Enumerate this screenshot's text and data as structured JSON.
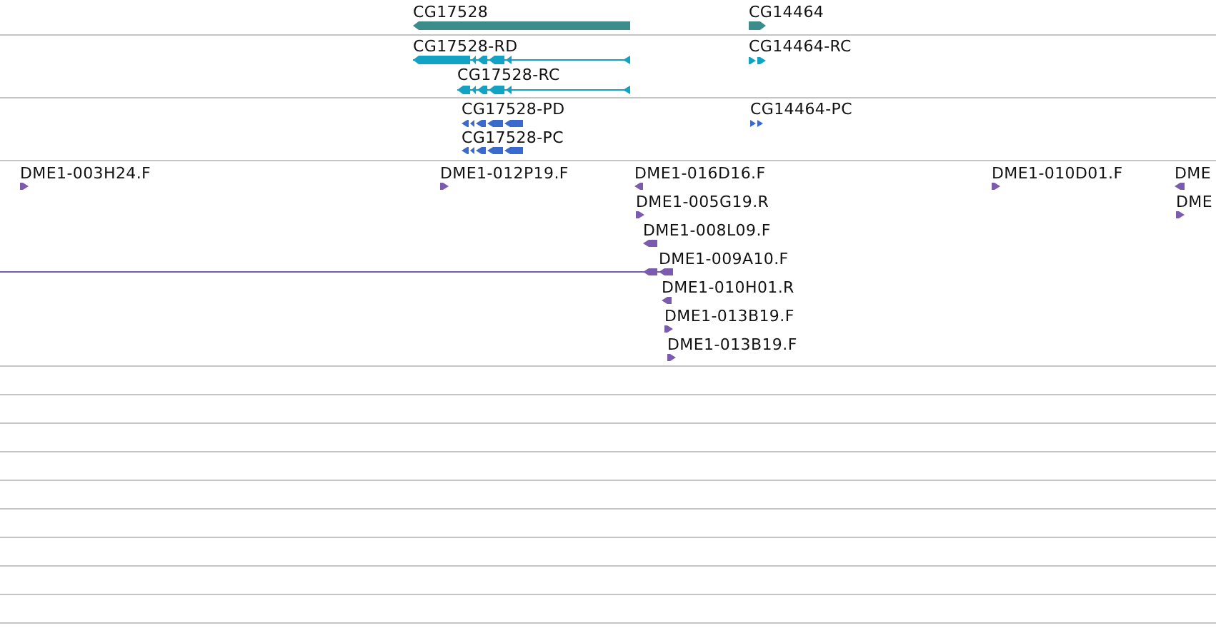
{
  "tracks": [
    {
      "color": "#3d8c8c",
      "features": [
        {
          "label": "CG17528",
          "reverse": true
        },
        {
          "label": "CG14464",
          "reverse": false
        }
      ]
    },
    {
      "color": "#12a3c4",
      "features": [
        {
          "label": "CG17528-RD",
          "reverse": true
        },
        {
          "label": "CG17528-RC",
          "reverse": true
        },
        {
          "label": "CG14464-RC",
          "reverse": false
        }
      ]
    },
    {
      "color": "#3a6acb",
      "features": [
        {
          "label": "CG17528-PD",
          "reverse": true
        },
        {
          "label": "CG17528-PC",
          "reverse": true
        },
        {
          "label": "CG14464-PC",
          "reverse": false
        }
      ]
    },
    {
      "color": "#7a5bad",
      "features": [
        {
          "label": "DME1-003H24.F",
          "reverse": false
        },
        {
          "label": "DME1-012P19.F",
          "reverse": false
        },
        {
          "label": "DME1-016D16.F",
          "reverse": true
        },
        {
          "label": "DME1-010D01.F",
          "reverse": false
        },
        {
          "label": "DME",
          "reverse": true
        },
        {
          "label": "DME1-005G19.R",
          "reverse": false
        },
        {
          "label": "DME",
          "reverse": false
        },
        {
          "label": "DME1-008L09.F",
          "reverse": true
        },
        {
          "label": "DME1-009A10.F",
          "reverse": true
        },
        {
          "label": "DME1-010H01.R",
          "reverse": true
        },
        {
          "label": "DME1-013B19.F",
          "reverse": false
        },
        {
          "label": "DME1-013B19.F",
          "reverse": false
        }
      ]
    }
  ]
}
